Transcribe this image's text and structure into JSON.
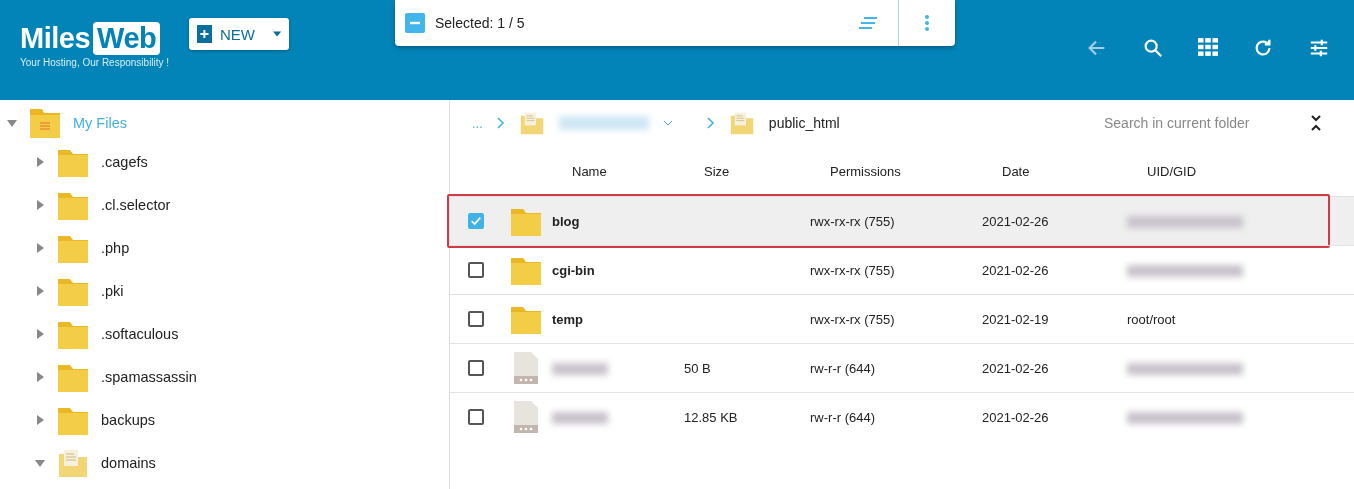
{
  "header": {
    "logo": {
      "word_1": "Miles",
      "word_2": "Web",
      "tagline": "Your Hosting, Our Responsibility !"
    },
    "new_button": {
      "label": "NEW"
    },
    "selection_bar": {
      "text": "Selected: 1 / 5"
    }
  },
  "tree": {
    "label": "My Files",
    "expanded": true,
    "children": [
      {
        "label": ".cagefs",
        "kind": "folder",
        "expanded": false
      },
      {
        "label": ".cl.selector",
        "kind": "folder",
        "expanded": false
      },
      {
        "label": ".php",
        "kind": "folder",
        "expanded": false
      },
      {
        "label": ".pki",
        "kind": "folder",
        "expanded": false
      },
      {
        "label": ".softaculous",
        "kind": "folder",
        "expanded": false
      },
      {
        "label": ".spamassassin",
        "kind": "folder",
        "expanded": false
      },
      {
        "label": "backups",
        "kind": "folder",
        "expanded": false
      },
      {
        "label": "domains",
        "kind": "document",
        "expanded": true
      }
    ]
  },
  "breadcrumb": {
    "ellipsis": "...",
    "current": "public_html"
  },
  "search": {
    "placeholder": "Search in current folder"
  },
  "table": {
    "columns": [
      "Name",
      "Size",
      "Permissions",
      "Date",
      "UID/GID"
    ],
    "rows": [
      {
        "kind": "folder",
        "selected": true,
        "name": "blog",
        "permissions": "rwx-rx-rx (755)",
        "date": "2021-02-26"
      },
      {
        "kind": "folder",
        "selected": false,
        "name": "cgi-bin",
        "permissions": "rwx-rx-rx (755)",
        "date": "2021-02-26"
      },
      {
        "kind": "folder",
        "selected": false,
        "name": "temp",
        "permissions": "rwx-rx-rx (755)",
        "date": "2021-02-19",
        "uid_gid": "root/root"
      },
      {
        "kind": "file",
        "selected": false,
        "size": "50 B",
        "permissions": "rw-r-r (644)",
        "date": "2021-02-26"
      },
      {
        "kind": "file",
        "selected": false,
        "size": "12.85 KB",
        "permissions": "rw-r-r (644)",
        "date": "2021-02-26"
      }
    ]
  }
}
